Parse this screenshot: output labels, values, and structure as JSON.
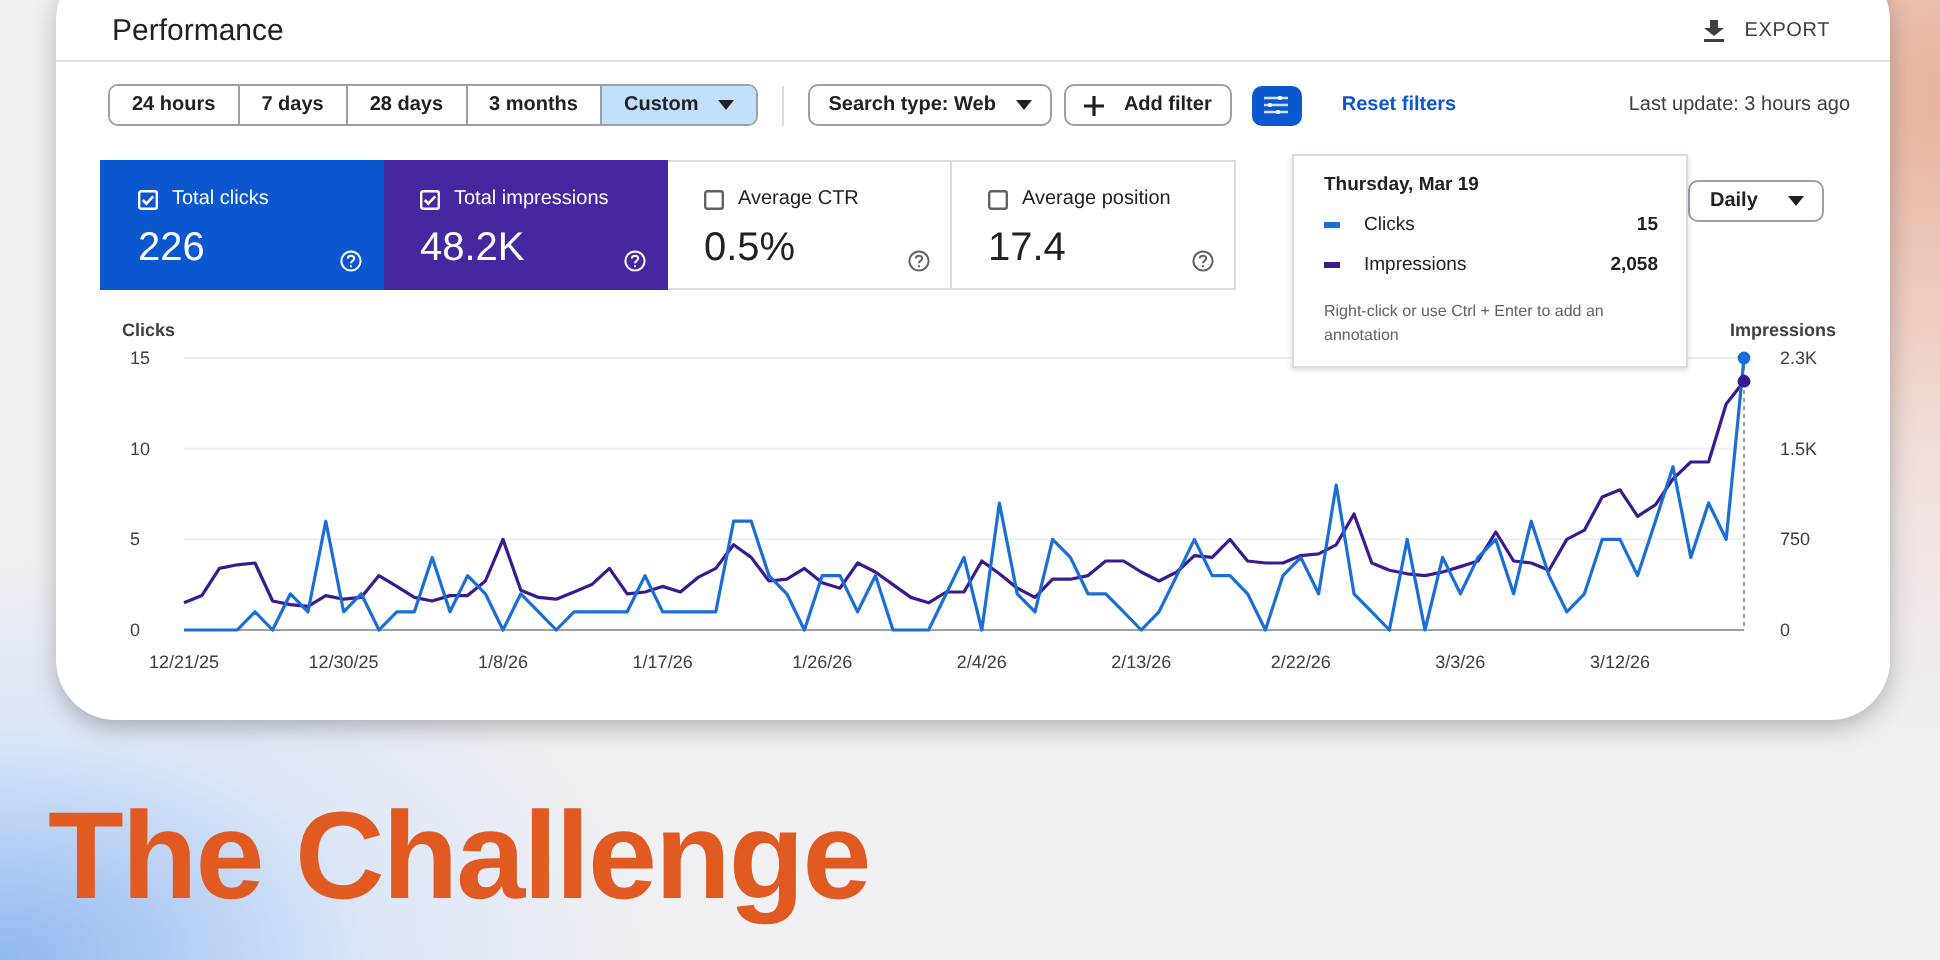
{
  "header": {
    "title": "Performance",
    "export_label": "EXPORT"
  },
  "filters": {
    "ranges": [
      {
        "label": "24 hours",
        "selected": false,
        "dropdown": false
      },
      {
        "label": "7 days",
        "selected": false,
        "dropdown": false
      },
      {
        "label": "28 days",
        "selected": false,
        "dropdown": false
      },
      {
        "label": "3 months",
        "selected": false,
        "dropdown": false
      },
      {
        "label": "Custom",
        "selected": true,
        "dropdown": true
      }
    ],
    "search_type": "Search type: Web",
    "add_filter": "Add filter",
    "reset": "Reset filters",
    "last_update": "Last update: 3 hours ago"
  },
  "metrics": [
    {
      "label": "Total clicks",
      "value": "226",
      "checked": true,
      "color": "#0b57d0"
    },
    {
      "label": "Total impressions",
      "value": "48.2K",
      "checked": true,
      "color": "#4527a0"
    },
    {
      "label": "Average CTR",
      "value": "0.5%",
      "checked": false
    },
    {
      "label": "Average position",
      "value": "17.4",
      "checked": false
    }
  ],
  "granularity": "Daily",
  "tooltip": {
    "date": "Thursday, Mar 19",
    "rows": [
      {
        "value": "15"
      },
      {
        "value": "2,058"
      }
    ],
    "hint": "Right-click or use Ctrl + Enter to add an annotation"
  },
  "chart_data": {
    "type": "line",
    "legend": "top-right",
    "ylabel": "Clicks",
    "y2label": "Impressions",
    "categories": [
      "12/21/25",
      null,
      null,
      null,
      null,
      null,
      null,
      null,
      null,
      "12/30/25",
      null,
      null,
      null,
      null,
      null,
      null,
      null,
      null,
      "1/8/26",
      null,
      null,
      null,
      null,
      null,
      null,
      null,
      null,
      "1/17/26",
      null,
      null,
      null,
      null,
      null,
      null,
      null,
      null,
      "1/26/26",
      null,
      null,
      null,
      null,
      null,
      null,
      null,
      null,
      "2/4/26",
      null,
      null,
      null,
      null,
      null,
      null,
      null,
      null,
      "2/13/26",
      null,
      null,
      null,
      null,
      null,
      null,
      null,
      null,
      "2/22/26",
      null,
      null,
      null,
      null,
      null,
      null,
      null,
      null,
      "3/3/26",
      null,
      null,
      null,
      null,
      null,
      null,
      null,
      null,
      "3/12/26",
      null,
      null,
      null,
      null,
      null,
      null,
      null
    ],
    "series": [
      {
        "name": "Clicks",
        "color": "#1a6fd6",
        "values": [
          0,
          0,
          0,
          0,
          1,
          0,
          2,
          1,
          6,
          1,
          2,
          0,
          1,
          1,
          4,
          1,
          3,
          2,
          0,
          2,
          1,
          0,
          1,
          1,
          1,
          1,
          3,
          1,
          1,
          1,
          1,
          6,
          6,
          3,
          2,
          0,
          3,
          3,
          1,
          3,
          0,
          0,
          0,
          2,
          4,
          0,
          7,
          2,
          1,
          5,
          4,
          2,
          2,
          1,
          0,
          1,
          3,
          5,
          3,
          3,
          2,
          0,
          3,
          4,
          2,
          8,
          2,
          1,
          0,
          5,
          0,
          4,
          2,
          4,
          5,
          2,
          6,
          3,
          1,
          2,
          5,
          5,
          3,
          6,
          9,
          4,
          7,
          5,
          15
        ]
      },
      {
        "name": "Impressions",
        "color": "#3b1a8f",
        "axis": "y2",
        "values": [
          225,
          285,
          510,
          540,
          555,
          240,
          210,
          195,
          285,
          255,
          270,
          450,
          360,
          270,
          240,
          285,
          285,
          405,
          750,
          330,
          270,
          255,
          315,
          375,
          510,
          300,
          315,
          360,
          315,
          435,
          510,
          705,
          600,
          405,
          420,
          510,
          390,
          345,
          555,
          480,
          375,
          270,
          225,
          315,
          315,
          570,
          465,
          345,
          270,
          420,
          420,
          450,
          570,
          570,
          480,
          405,
          480,
          615,
          600,
          750,
          570,
          555,
          555,
          615,
          630,
          705,
          960,
          555,
          495,
          465,
          450,
          480,
          525,
          570,
          810,
          570,
          555,
          495,
          750,
          825,
          1100,
          1160,
          940,
          1035,
          1250,
          1390,
          1390,
          1870,
          2058
        ]
      }
    ],
    "ylim": [
      0,
      15
    ],
    "y2lim": [
      0,
      2250
    ],
    "yticks": [
      0,
      5,
      10,
      15
    ],
    "y2ticks": [
      {
        "value": 0,
        "label": "0"
      },
      {
        "value": 750,
        "label": "750"
      },
      {
        "value": 1500,
        "label": "1.5K"
      },
      {
        "value": 2250,
        "label": "2.3K"
      }
    ]
  },
  "headline": "The Challenge"
}
